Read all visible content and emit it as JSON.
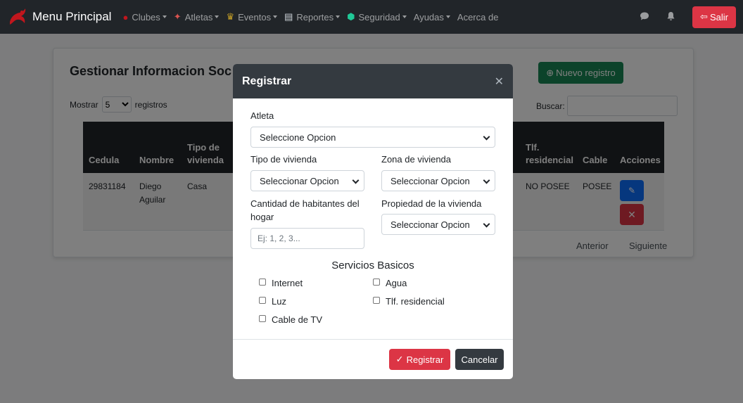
{
  "navbar": {
    "brand": "Menu Principal",
    "items": [
      {
        "label": "Clubes",
        "icon": "boxing-glove-icon",
        "dropdown": true
      },
      {
        "label": "Atletas",
        "icon": "athlete-icon",
        "dropdown": true
      },
      {
        "label": "Eventos",
        "icon": "trophy-icon",
        "dropdown": true
      },
      {
        "label": "Reportes",
        "icon": "report-icon",
        "dropdown": true
      },
      {
        "label": "Seguridad",
        "icon": "shield-icon",
        "dropdown": true
      },
      {
        "label": "Ayudas",
        "icon": "",
        "dropdown": true
      },
      {
        "label": "Acerca de",
        "icon": "",
        "dropdown": false
      }
    ],
    "logout": "Salir"
  },
  "page": {
    "title": "Gestionar Informacion Soc",
    "new_button": "Nuevo registro",
    "show_prefix": "Mostrar",
    "show_value": "5",
    "show_suffix": "registros",
    "search_label": "Buscar:",
    "table": {
      "headers": [
        "Cedula",
        "Nombre",
        "Tipo de vivienda",
        "Tlf. residencial",
        "Cable",
        "Acciones"
      ],
      "rows": [
        {
          "cedula": "29831184",
          "nombre": "Diego Aguilar",
          "tipo": "Casa",
          "tlf": "NO POSEE",
          "cable": "POSEE"
        }
      ]
    },
    "prev": "Anterior",
    "next": "Siguiente"
  },
  "modal": {
    "title": "Registrar",
    "athlete_label": "Atleta",
    "athlete_value": "Seleccione Opcion",
    "housing_type_label": "Tipo de vivienda",
    "housing_type_value": "Seleccionar Opcion",
    "housing_zone_label": "Zona de vivienda",
    "housing_zone_value": "Seleccionar Opcion",
    "inhabitants_label": "Cantidad de habitantes del hogar",
    "inhabitants_placeholder": "Ej: 1, 2, 3...",
    "property_label": "Propiedad de la vivienda",
    "property_value": "Seleccionar Opcion",
    "services_title": "Servicios Basicos",
    "services": [
      "Internet",
      "Agua",
      "Luz",
      "Tlf. residencial",
      "Cable de TV"
    ],
    "submit": "Registrar",
    "cancel": "Cancelar"
  },
  "colors": {
    "navbar": "#212529",
    "danger": "#dc3545",
    "success": "#198754",
    "primary": "#0d6efd",
    "modal_header": "#343a40"
  }
}
